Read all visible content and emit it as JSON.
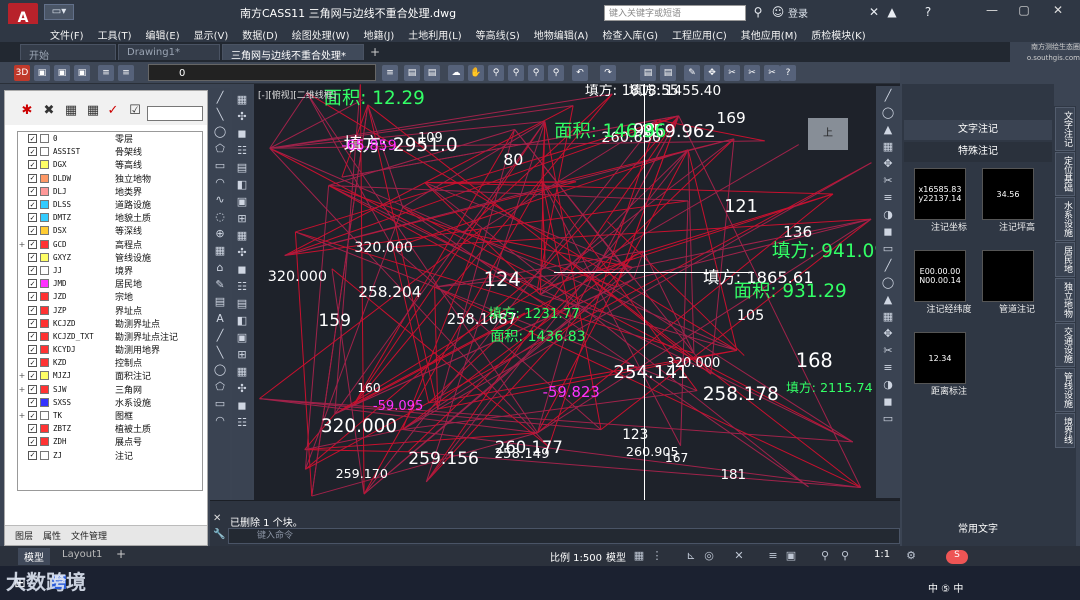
{
  "title": "南方CASS11 三角网与边线不重合处理.dwg",
  "search_placeholder": "键入关键字或短语",
  "login": "登录",
  "brand": "南方测绘生态圈 o.southgis.com",
  "menus": [
    "文件(F)",
    "工具(T)",
    "编辑(E)",
    "显示(V)",
    "数据(D)",
    "绘图处理(W)",
    "地籍(J)",
    "土地利用(L)",
    "等高线(S)",
    "地物编辑(A)",
    "检查入库(G)",
    "工程应用(C)",
    "其他应用(M)",
    "质检模块(K)"
  ],
  "tabs": [
    "开始",
    "Drawing1*",
    "三角网与边线不重合处理*"
  ],
  "layer_combo": "0",
  "layers": [
    {
      "name": "0",
      "desc": "零层",
      "color": "#ffffff",
      "exp": ""
    },
    {
      "name": "ASSIST",
      "desc": "骨架线",
      "color": "#ffffff",
      "exp": ""
    },
    {
      "name": "DGX",
      "desc": "等高线",
      "color": "#ffff66",
      "exp": ""
    },
    {
      "name": "DLDW",
      "desc": "独立地物",
      "color": "#ff9966",
      "exp": ""
    },
    {
      "name": "DLJ",
      "desc": "地类界",
      "color": "#ff9999",
      "exp": ""
    },
    {
      "name": "DLSS",
      "desc": "道路设施",
      "color": "#33ccff",
      "exp": ""
    },
    {
      "name": "DMTZ",
      "desc": "地貌土质",
      "color": "#33ccff",
      "exp": ""
    },
    {
      "name": "DSX",
      "desc": "等深线",
      "color": "#ffcc33",
      "exp": ""
    },
    {
      "name": "GCD",
      "desc": "高程点",
      "color": "#ff3333",
      "exp": "+"
    },
    {
      "name": "GXYZ",
      "desc": "管线设施",
      "color": "#ffff66",
      "exp": ""
    },
    {
      "name": "JJ",
      "desc": "境界",
      "color": "#ffffff",
      "exp": ""
    },
    {
      "name": "JMD",
      "desc": "居民地",
      "color": "#ff33ff",
      "exp": ""
    },
    {
      "name": "JZD",
      "desc": "宗地",
      "color": "#ff3333",
      "exp": ""
    },
    {
      "name": "JZP",
      "desc": "界址点",
      "color": "#ff3333",
      "exp": ""
    },
    {
      "name": "KCJZD",
      "desc": "勘测界址点",
      "color": "#ff3333",
      "exp": ""
    },
    {
      "name": "KCJZD_TXT",
      "desc": "勘测界址点注记",
      "color": "#ff3333",
      "exp": ""
    },
    {
      "name": "KCYDJ",
      "desc": "勘测用地界",
      "color": "#ff3333",
      "exp": ""
    },
    {
      "name": "KZD",
      "desc": "控制点",
      "color": "#ff3333",
      "exp": ""
    },
    {
      "name": "MJZJ",
      "desc": "面积注记",
      "color": "#ffff66",
      "exp": "+"
    },
    {
      "name": "SJW",
      "desc": "三角网",
      "color": "#ff3333",
      "exp": "+"
    },
    {
      "name": "SXSS",
      "desc": "水系设施",
      "color": "#3333ff",
      "exp": ""
    },
    {
      "name": "TK",
      "desc": "图框",
      "color": "#ffffff",
      "exp": "+"
    },
    {
      "name": "ZBTZ",
      "desc": "植被土质",
      "color": "#ff3333",
      "exp": ""
    },
    {
      "name": "ZDH",
      "desc": "展点号",
      "color": "#ff3333",
      "exp": ""
    },
    {
      "name": "ZJ",
      "desc": "注记",
      "color": "#ffffff",
      "exp": ""
    }
  ],
  "panel_tabs": [
    "图层",
    "属性",
    "文件管理"
  ],
  "viewport_label": "[-][俯视][二维线框]",
  "command_history": "已删除 1 个块。",
  "command_placeholder": "键入命令",
  "right_panel": {
    "header": "文字注记",
    "subheader": "特殊注记",
    "tiles": [
      {
        "label": "注记坐标",
        "line1": "x16585.83",
        "line2": "y22137.14"
      },
      {
        "label": "注记坪高",
        "line1": "34.56",
        "line2": ""
      },
      {
        "label": "注记经纬度",
        "line1": "E00.00.00",
        "line2": "N00.00.14"
      },
      {
        "label": "管道注记",
        "line1": "",
        "line2": ""
      },
      {
        "label": "距离标注",
        "line1": "12.34",
        "line2": ""
      }
    ],
    "footer": "常用文字"
  },
  "side_tabs": [
    "文字注记",
    "定位基础",
    "水系设施",
    "居民地",
    "独立地物",
    "交通设施",
    "管线设施",
    "境界线"
  ],
  "status": {
    "model_tab": "模型",
    "layout_tab": "Layout1",
    "scale": "比例 1:500",
    "model": "模型",
    "zoom": "1:1"
  },
  "watermark": "大数跨境",
  "tray": "中 ⑤ 中",
  "canvas_texts": [
    {
      "t": "260.905",
      "c": "#ffffff"
    },
    {
      "t": "-59.095",
      "c": "#ff33ff"
    },
    {
      "t": "320.000",
      "c": "#ffffff"
    },
    {
      "t": "填方: 1865.61",
      "c": "#ffffff"
    },
    {
      "t": "98",
      "c": "#ffffff"
    },
    {
      "t": "填方: 2951.0",
      "c": "#ffffff"
    },
    {
      "t": "填方: 1455.40",
      "c": "#ffffff"
    },
    {
      "t": "260.630",
      "c": "#ffffff"
    },
    {
      "t": "260.177",
      "c": "#ffffff"
    },
    {
      "t": "-59.823",
      "c": "#ff33ff"
    },
    {
      "t": "109",
      "c": "#ffffff"
    },
    {
      "t": "320.000",
      "c": "#ffffff"
    },
    {
      "t": "填方: 1818.55",
      "c": "#ffffff"
    },
    {
      "t": "136",
      "c": "#ffffff"
    },
    {
      "t": "123",
      "c": "#ffffff"
    },
    {
      "t": "259.170",
      "c": "#ffffff"
    },
    {
      "t": "169",
      "c": "#ffffff"
    },
    {
      "t": "159",
      "c": "#ffffff"
    },
    {
      "t": "258.149",
      "c": "#ffffff"
    },
    {
      "t": "258.204",
      "c": "#ffffff"
    },
    {
      "t": "258.178",
      "c": "#ffffff"
    },
    {
      "t": "259.962",
      "c": "#ffffff"
    },
    {
      "t": "259.156",
      "c": "#ffffff"
    },
    {
      "t": "168",
      "c": "#ffffff"
    },
    {
      "t": "160",
      "c": "#ffffff"
    },
    {
      "t": "258.1087",
      "c": "#ffffff"
    },
    {
      "t": "105",
      "c": "#ffffff"
    },
    {
      "t": "-65.859",
      "c": "#ff33ff"
    },
    {
      "t": "254.141",
      "c": "#ffffff"
    },
    {
      "t": "320.000",
      "c": "#ffffff"
    },
    {
      "t": "面积: 931.29",
      "c": "#33ff66"
    },
    {
      "t": "填方: 1231.77",
      "c": "#33ff66"
    },
    {
      "t": "121",
      "c": "#ffffff"
    },
    {
      "t": "面积: 146.96",
      "c": "#33ff66"
    },
    {
      "t": "填方: 941.09",
      "c": "#33ff66"
    },
    {
      "t": "面积: 1436.83",
      "c": "#33ff66"
    },
    {
      "t": "80",
      "c": "#ffffff"
    },
    {
      "t": "124",
      "c": "#ffffff"
    },
    {
      "t": "167",
      "c": "#ffffff"
    },
    {
      "t": "181",
      "c": "#ffffff"
    },
    {
      "t": "面积: 12.29",
      "c": "#33ff66"
    },
    {
      "t": "320.000",
      "c": "#ffffff"
    },
    {
      "t": "填方: 2115.74",
      "c": "#33ff66"
    }
  ]
}
